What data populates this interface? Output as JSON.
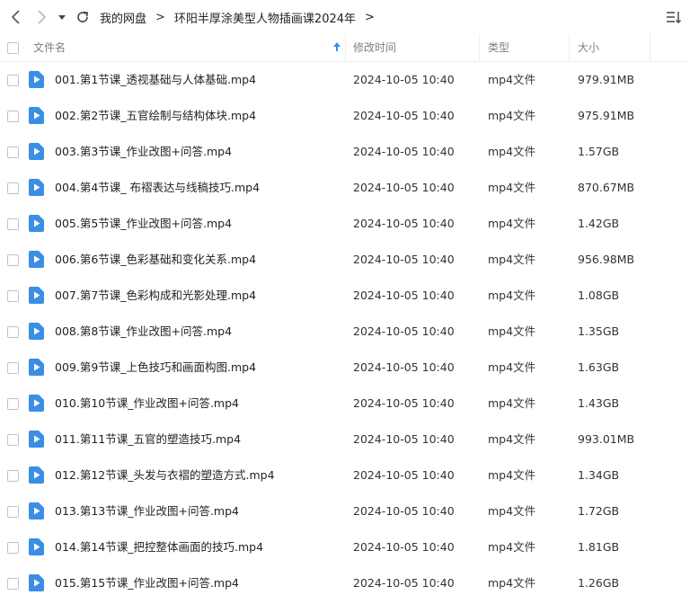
{
  "toolbar": {
    "back_icon": "chevron-left-icon",
    "forward_icon": "chevron-right-icon",
    "history_icon": "caret-down-icon",
    "refresh_icon": "refresh-icon",
    "sort_icon": "sort-list-icon"
  },
  "breadcrumb": {
    "root": "我的网盘",
    "separator": ">",
    "current": "环阳半厚涂美型人物插画课2024年",
    "expand_arrow": ">"
  },
  "columns": {
    "name": "文件名",
    "modified": "修改时间",
    "type": "类型",
    "size": "大小"
  },
  "colors": {
    "accent": "#3a8ee6",
    "file_icon": "#3a8ee6"
  },
  "files": [
    {
      "name": "001.第1节课_透视基础与人体基础.mp4",
      "modified": "2024-10-05 10:40",
      "type": "mp4文件",
      "size": "979.91MB"
    },
    {
      "name": "002.第2节课_五官绘制与结构体块.mp4",
      "modified": "2024-10-05 10:40",
      "type": "mp4文件",
      "size": "975.91MB"
    },
    {
      "name": "003.第3节课_作业改图+问答.mp4",
      "modified": "2024-10-05 10:40",
      "type": "mp4文件",
      "size": "1.57GB"
    },
    {
      "name": "004.第4节课_ 布褶表达与线稿技巧.mp4",
      "modified": "2024-10-05 10:40",
      "type": "mp4文件",
      "size": "870.67MB"
    },
    {
      "name": "005.第5节课_作业改图+问答.mp4",
      "modified": "2024-10-05 10:40",
      "type": "mp4文件",
      "size": "1.42GB"
    },
    {
      "name": "006.第6节课_色彩基础和变化关系.mp4",
      "modified": "2024-10-05 10:40",
      "type": "mp4文件",
      "size": "956.98MB"
    },
    {
      "name": "007.第7节课_色彩构成和光影处理.mp4",
      "modified": "2024-10-05 10:40",
      "type": "mp4文件",
      "size": "1.08GB"
    },
    {
      "name": "008.第8节课_作业改图+问答.mp4",
      "modified": "2024-10-05 10:40",
      "type": "mp4文件",
      "size": "1.35GB"
    },
    {
      "name": "009.第9节课_上色技巧和画面构图.mp4",
      "modified": "2024-10-05 10:40",
      "type": "mp4文件",
      "size": "1.63GB"
    },
    {
      "name": "010.第10节课_作业改图+问答.mp4",
      "modified": "2024-10-05 10:40",
      "type": "mp4文件",
      "size": "1.43GB"
    },
    {
      "name": "011.第11节课_五官的塑造技巧.mp4",
      "modified": "2024-10-05 10:40",
      "type": "mp4文件",
      "size": "993.01MB"
    },
    {
      "name": "012.第12节课_头发与衣褶的塑造方式.mp4",
      "modified": "2024-10-05 10:40",
      "type": "mp4文件",
      "size": "1.34GB"
    },
    {
      "name": "013.第13节课_作业改图+问答.mp4",
      "modified": "2024-10-05 10:40",
      "type": "mp4文件",
      "size": "1.72GB"
    },
    {
      "name": "014.第14节课_把控整体画面的技巧.mp4",
      "modified": "2024-10-05 10:40",
      "type": "mp4文件",
      "size": "1.81GB"
    },
    {
      "name": "015.第15节课_作业改图+问答.mp4",
      "modified": "2024-10-05 10:40",
      "type": "mp4文件",
      "size": "1.26GB"
    }
  ]
}
